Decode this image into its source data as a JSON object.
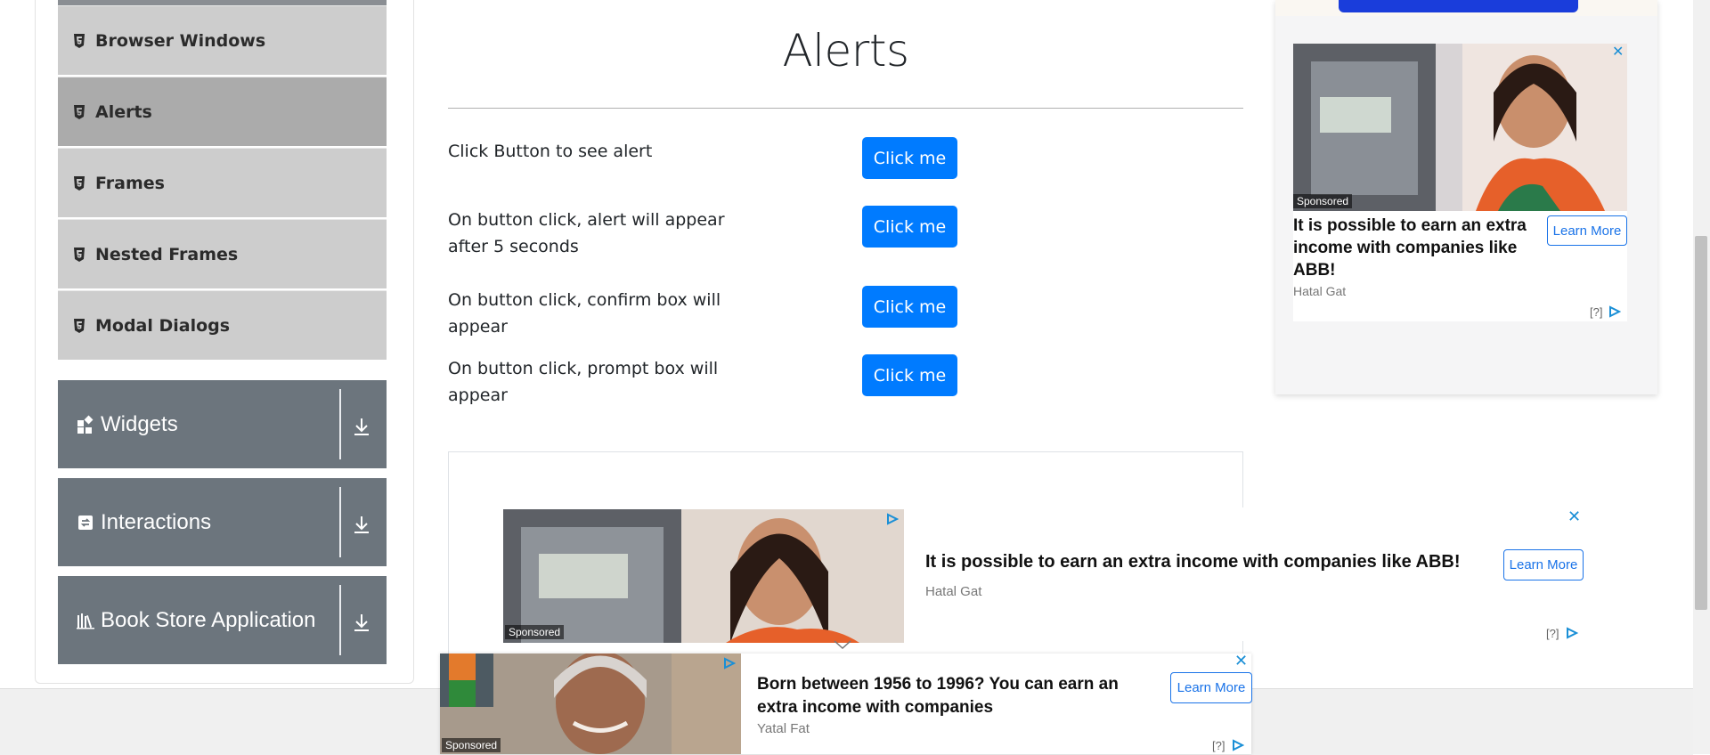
{
  "sidebar": {
    "sub_items": [
      {
        "label": "Browser Windows",
        "active": false
      },
      {
        "label": "Alerts",
        "active": true
      },
      {
        "label": "Frames",
        "active": false
      },
      {
        "label": "Nested Frames",
        "active": false
      },
      {
        "label": "Modal Dialogs",
        "active": false
      }
    ],
    "groups": [
      {
        "label": "Widgets",
        "icon": "widgets-icon"
      },
      {
        "label": "Interactions",
        "icon": "interactions-icon"
      },
      {
        "label": "Book Store Application",
        "icon": "book-store-icon"
      }
    ]
  },
  "main": {
    "title": "Alerts",
    "rows": [
      {
        "text": "Click Button to see alert",
        "button": "Click me"
      },
      {
        "text": "On button click, alert will appear after 5 seconds",
        "button": "Click me"
      },
      {
        "text": "On button click, confirm box will appear",
        "button": "Click me"
      },
      {
        "text": "On button click, prompt box will appear",
        "button": "Click me"
      }
    ]
  },
  "ads": {
    "right": {
      "sponsored": "Sponsored",
      "headline": "It is possible to earn an extra income with companies like ABB!",
      "source": "Hatal Gat",
      "cta": "Learn More",
      "help": "[?]",
      "close": "✕"
    },
    "middle": {
      "sponsored": "Sponsored",
      "headline": "It is possible to earn an extra income with companies like ABB!",
      "source": "Hatal Gat",
      "cta": "Learn More",
      "help": "[?]",
      "close": "✕"
    },
    "bottom": {
      "sponsored": "Sponsored",
      "headline": "Born between 1956 to 1996? You can earn an extra income with companies",
      "source": "Yatal Fat",
      "cta": "Learn More",
      "help": "[?]",
      "close": "✕"
    }
  },
  "colors": {
    "primary_button": "#007bff",
    "sidebar_group": "#6c757d",
    "sidebar_item": "#cdcdcd",
    "sidebar_item_active": "#ababab",
    "ad_link": "#1a73e8"
  }
}
